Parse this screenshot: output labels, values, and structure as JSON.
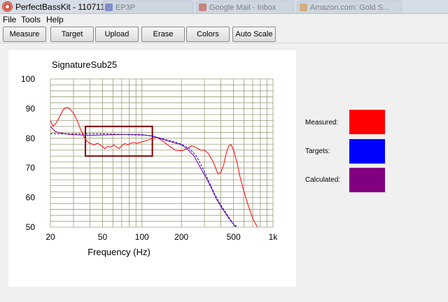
{
  "window": {
    "title": "PerfectBassKit - 110711",
    "background_tabs": [
      {
        "label": "EP3P",
        "color": "#3a4fb8"
      },
      {
        "label": "Google Mail - Inbox",
        "color": "#c43a2e"
      },
      {
        "label": "Amazon.com: Gold S...",
        "color": "#d08a2a"
      }
    ]
  },
  "menu": {
    "items": [
      {
        "label": "File"
      },
      {
        "label": "Tools"
      },
      {
        "label": "Help"
      }
    ]
  },
  "toolbar": {
    "buttons": [
      {
        "label": "Measure"
      },
      {
        "label": "Target"
      },
      {
        "label": "Upload"
      },
      {
        "label": "Erase"
      },
      {
        "label": "Colors"
      },
      {
        "label": "Auto Scale"
      }
    ]
  },
  "legend": {
    "items": [
      {
        "label": "Measured:",
        "color": "#ff0000"
      },
      {
        "label": "Targets:",
        "color": "#0000ff"
      },
      {
        "label": "Calculated:",
        "color": "#800080"
      }
    ]
  },
  "chart_data": {
    "type": "line",
    "title": "SignatureSub25",
    "xlabel": "Frequency (Hz)",
    "ylabel": "",
    "x_scale": "log",
    "xlim": [
      20,
      1000
    ],
    "ylim": [
      50,
      100
    ],
    "x_ticks": [
      {
        "value": 20,
        "label": "20"
      },
      {
        "value": 50,
        "label": "50"
      },
      {
        "value": 100,
        "label": "100"
      },
      {
        "value": 200,
        "label": "200"
      },
      {
        "value": 500,
        "label": "500"
      },
      {
        "value": 1000,
        "label": "1k"
      }
    ],
    "y_ticks": [
      {
        "value": 50,
        "label": "50"
      },
      {
        "value": 60,
        "label": "60"
      },
      {
        "value": 70,
        "label": "70"
      },
      {
        "value": 80,
        "label": "80"
      },
      {
        "value": 90,
        "label": "90"
      },
      {
        "value": 100,
        "label": "100"
      }
    ],
    "grid": true,
    "grid_color": "#9a9a78",
    "highlight_box": {
      "x": [
        37,
        120
      ],
      "y": [
        74,
        84
      ],
      "color": "#800000"
    },
    "series": [
      {
        "name": "Measured",
        "color": "#ff0000",
        "style": "solid",
        "points": [
          [
            20,
            86
          ],
          [
            21,
            84
          ],
          [
            22,
            85
          ],
          [
            24,
            88
          ],
          [
            25,
            89.5
          ],
          [
            26,
            90.3
          ],
          [
            27,
            90.4
          ],
          [
            28,
            90
          ],
          [
            30,
            88.5
          ],
          [
            32,
            86
          ],
          [
            34,
            83
          ],
          [
            36,
            80.5
          ],
          [
            38,
            79
          ],
          [
            40,
            78.3
          ],
          [
            43,
            77.8
          ],
          [
            46,
            78.3
          ],
          [
            49,
            77.5
          ],
          [
            52,
            76.5
          ],
          [
            55,
            77.3
          ],
          [
            58,
            77
          ],
          [
            61,
            77.8
          ],
          [
            64,
            77
          ],
          [
            67,
            76.5
          ],
          [
            70,
            77.5
          ],
          [
            74,
            78.2
          ],
          [
            78,
            77.8
          ],
          [
            82,
            78.3
          ],
          [
            86,
            78.6
          ],
          [
            92,
            78.3
          ],
          [
            100,
            78.8
          ],
          [
            110,
            79.3
          ],
          [
            120,
            80
          ],
          [
            130,
            80.3
          ],
          [
            145,
            79
          ],
          [
            160,
            77.5
          ],
          [
            180,
            76
          ],
          [
            200,
            75.8
          ],
          [
            220,
            76.5
          ],
          [
            240,
            77.5
          ],
          [
            260,
            76.8
          ],
          [
            280,
            76
          ],
          [
            300,
            76
          ],
          [
            320,
            75
          ],
          [
            350,
            72
          ],
          [
            380,
            68
          ],
          [
            400,
            68.5
          ],
          [
            420,
            71
          ],
          [
            440,
            75
          ],
          [
            460,
            77.5
          ],
          [
            480,
            77.8
          ],
          [
            500,
            76
          ],
          [
            530,
            72
          ],
          [
            560,
            67
          ],
          [
            600,
            62
          ],
          [
            650,
            57
          ],
          [
            700,
            53
          ],
          [
            760,
            50
          ]
        ]
      },
      {
        "name": "Targets",
        "color": "#0000ff",
        "style": "dashed",
        "points": [
          [
            20,
            81.5
          ],
          [
            30,
            81.5
          ],
          [
            50,
            81.5
          ],
          [
            80,
            81.2
          ],
          [
            110,
            81
          ],
          [
            140,
            80
          ],
          [
            170,
            79
          ],
          [
            200,
            78
          ],
          [
            230,
            76.5
          ],
          [
            260,
            74
          ],
          [
            290,
            70
          ],
          [
            320,
            66
          ],
          [
            360,
            61
          ],
          [
            400,
            57.5
          ],
          [
            450,
            54
          ],
          [
            500,
            51
          ],
          [
            540,
            50
          ]
        ]
      },
      {
        "name": "Calculated",
        "color": "#800080",
        "style": "solid",
        "points": [
          [
            20,
            84
          ],
          [
            21,
            83
          ],
          [
            22,
            82.2
          ],
          [
            24,
            81.8
          ],
          [
            27,
            81.4
          ],
          [
            30,
            81.2
          ],
          [
            40,
            81
          ],
          [
            60,
            81.2
          ],
          [
            80,
            81.3
          ],
          [
            100,
            81.2
          ],
          [
            120,
            80.8
          ],
          [
            140,
            79.8
          ],
          [
            160,
            79
          ],
          [
            180,
            78.4
          ],
          [
            200,
            77.8
          ],
          [
            220,
            76.5
          ],
          [
            250,
            74
          ],
          [
            280,
            70
          ],
          [
            310,
            66.5
          ],
          [
            340,
            63
          ],
          [
            370,
            59.5
          ],
          [
            400,
            57
          ],
          [
            430,
            55
          ],
          [
            460,
            53
          ],
          [
            490,
            51.5
          ],
          [
            520,
            50
          ]
        ]
      }
    ]
  }
}
